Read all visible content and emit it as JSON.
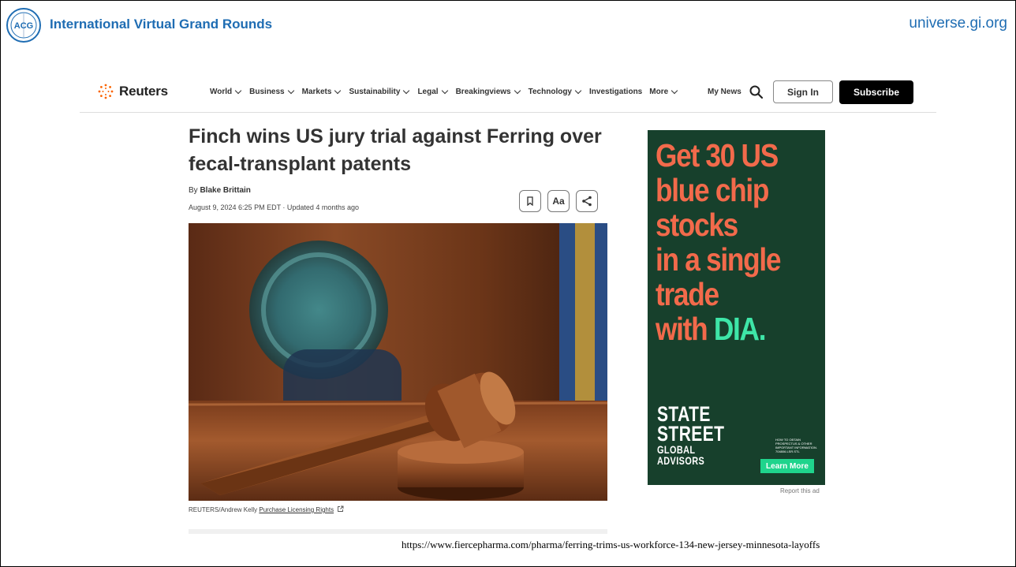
{
  "slide": {
    "title": "International Virtual Grand Rounds",
    "site": "universe.gi.org",
    "logo_text": "ACG",
    "source_url": "https://www.fiercepharma.com/pharma/ferring-trims-us-workforce-134-new-jersey-minnesota-layoffs"
  },
  "reuters": {
    "brand": "Reuters",
    "nav": [
      {
        "label": "World",
        "chevron": true
      },
      {
        "label": "Business",
        "chevron": true
      },
      {
        "label": "Markets",
        "chevron": true
      },
      {
        "label": "Sustainability",
        "chevron": true
      },
      {
        "label": "Legal",
        "chevron": true
      },
      {
        "label": "Breakingviews",
        "chevron": true
      },
      {
        "label": "Technology",
        "chevron": true
      },
      {
        "label": "Investigations",
        "chevron": false
      },
      {
        "label": "More",
        "chevron": true
      }
    ],
    "my_news": "My News",
    "sign_in": "Sign In",
    "subscribe": "Subscribe"
  },
  "article": {
    "headline": "Finch wins US jury trial against Ferring over fecal-transplant patents",
    "by_prefix": "By",
    "author": "Blake Brittain",
    "dateline": "August 9, 2024 6:25 PM EDT · Updated 4 months ago",
    "text_size_label": "Aa",
    "photo_credit": "REUTERS/Andrew Kelly",
    "licensing_link": "Purchase Licensing Rights"
  },
  "ad": {
    "line1": "Get 30 US",
    "line2": "blue chip",
    "line3": "stocks",
    "line4": "in a single",
    "line5": "trade",
    "line6_prefix": "with ",
    "line6_highlight": "DIA.",
    "brand_line1": "STATE",
    "brand_line2": "STREET",
    "brand_line3": "GLOBAL",
    "brand_line4": "ADVISORS",
    "fine_print": "HOW TO OBTAIN PROSPECTUS & OTHER IMPORTANT INFORMATION. 704806.LSR.STL",
    "cta": "Learn More",
    "report": "Report this ad"
  },
  "colors": {
    "acg_blue": "#1f6db3",
    "reuters_orange": "#fa6400",
    "ad_background": "#17402c",
    "ad_headline": "#f26a4b",
    "ad_highlight": "#3ee6a8"
  }
}
